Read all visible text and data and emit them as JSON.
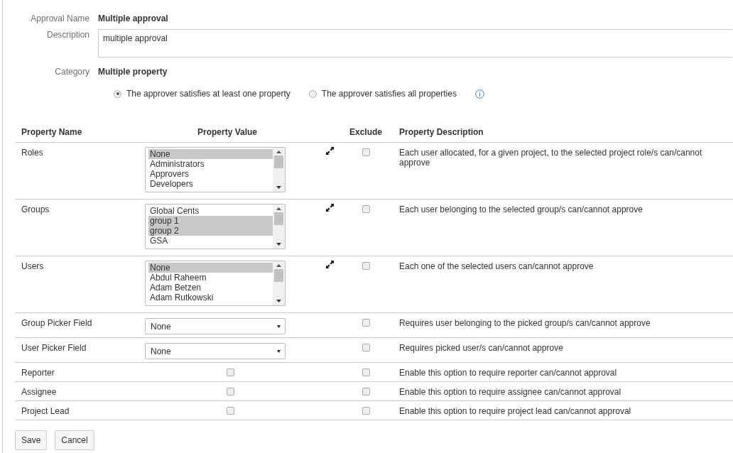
{
  "approval_name": {
    "label": "Approval Name",
    "value": "Multiple approval"
  },
  "description": {
    "label": "Description",
    "value": "multiple approval"
  },
  "category": {
    "label": "Category",
    "value": "Multiple property"
  },
  "match_options": [
    {
      "label": "The approver satisfies at least one property",
      "selected": true
    },
    {
      "label": "The approver satisfies all properties",
      "selected": false
    }
  ],
  "table": {
    "columns": [
      "Property Name",
      "Property Value",
      "Exclude",
      "Property Description"
    ],
    "rows": [
      {
        "name": "Roles",
        "kind": "list",
        "options": [
          {
            "label": "None",
            "selected": true
          },
          {
            "label": "Administrators",
            "selected": false
          },
          {
            "label": "Approvers",
            "selected": false
          },
          {
            "label": "Developers",
            "selected": false
          }
        ],
        "exclude": false,
        "description": "Each user allocated, for a given project, to the selected project role/s can/cannot approve"
      },
      {
        "name": "Groups",
        "kind": "list",
        "options": [
          {
            "label": "Global Cents",
            "selected": false
          },
          {
            "label": "group 1",
            "selected": true
          },
          {
            "label": "group 2",
            "selected": true
          },
          {
            "label": "GSA",
            "selected": false
          }
        ],
        "exclude": false,
        "description": "Each user belonging to the selected group/s can/cannot approve"
      },
      {
        "name": "Users",
        "kind": "list",
        "options": [
          {
            "label": "None",
            "selected": true
          },
          {
            "label": "Abdul Raheem",
            "selected": false
          },
          {
            "label": "Adam Betzen",
            "selected": false
          },
          {
            "label": "Adam Rutkowski",
            "selected": false
          }
        ],
        "exclude": false,
        "description": "Each one of the selected users can/cannot approve"
      },
      {
        "name": "Group Picker Field",
        "kind": "select",
        "value": "None",
        "exclude": false,
        "description": "Requires user belonging to the picked group/s can/cannot approve"
      },
      {
        "name": "User Picker Field",
        "kind": "select",
        "value": "None",
        "exclude": false,
        "description": "Requires picked user/s can/cannot approve"
      },
      {
        "name": "Reporter",
        "kind": "checkbox",
        "checked": false,
        "exclude": false,
        "description": "Enable this option to require reporter can/cannot approval"
      },
      {
        "name": "Assignee",
        "kind": "checkbox",
        "checked": false,
        "exclude": false,
        "description": "Enable this option to require assignee can/cannot approval"
      },
      {
        "name": "Project Lead",
        "kind": "checkbox",
        "checked": false,
        "exclude": false,
        "description": "Enable this option to require project lead can/cannot approval"
      }
    ]
  },
  "buttons": [
    "Save",
    "Cancel"
  ]
}
